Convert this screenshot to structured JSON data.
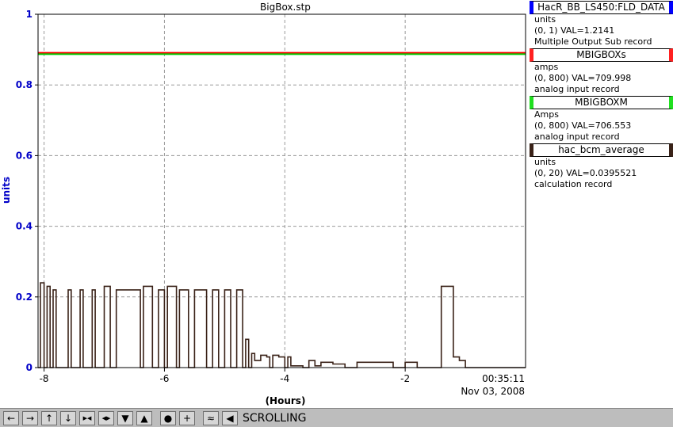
{
  "chart_data": {
    "type": "line",
    "title": "BigBox.stp",
    "xlabel": "(Hours)",
    "ylabel": "units",
    "xlim": [
      -8.1,
      0.0
    ],
    "ylim": [
      0,
      1
    ],
    "x_ticks": [
      "-8",
      "-6",
      "-4",
      "-2"
    ],
    "x_tick_values": [
      -8,
      -6,
      -4,
      -2
    ],
    "y_ticks": [
      "0",
      "0.2",
      "0.4",
      "0.6",
      "0.8",
      "1"
    ],
    "y_tick_values": [
      0,
      0.2,
      0.4,
      0.6,
      0.8,
      1
    ],
    "end_time": "00:35:11",
    "end_date": "Nov 03, 2008",
    "grid": true,
    "series": [
      {
        "name": "HacR_BB_LS450:FLD_DATA",
        "color": "#0000ff",
        "x": [
          -8.1,
          0
        ],
        "y": [
          0.889,
          0.889
        ]
      },
      {
        "name": "MBIGBOXs",
        "color": "#ff0000",
        "x": [
          -8.1,
          0
        ],
        "y": [
          0.891,
          0.891
        ]
      },
      {
        "name": "MBIGBOXM",
        "color": "#00c800",
        "x": [
          -8.1,
          0
        ],
        "y": [
          0.887,
          0.887
        ]
      },
      {
        "name": "hac_bcm_average",
        "color": "#3a2218",
        "x": [
          -8.1,
          -8.06,
          -8.0,
          -7.95,
          -7.9,
          -7.85,
          -7.8,
          -7.6,
          -7.55,
          -7.4,
          -7.35,
          -7.2,
          -7.15,
          -7.0,
          -6.9,
          -6.8,
          -6.7,
          -6.6,
          -6.4,
          -6.35,
          -6.2,
          -6.1,
          -6.0,
          -5.95,
          -5.8,
          -5.75,
          -5.6,
          -5.5,
          -5.4,
          -5.3,
          -5.2,
          -5.1,
          -5.0,
          -4.9,
          -4.8,
          -4.7,
          -4.65,
          -4.6,
          -4.55,
          -4.5,
          -4.4,
          -4.3,
          -4.25,
          -4.2,
          -4.1,
          -4.0,
          -3.95,
          -3.9,
          -3.8,
          -3.7,
          -3.6,
          -3.5,
          -3.4,
          -3.3,
          -3.2,
          -3.0,
          -2.8,
          -2.6,
          -2.4,
          -2.2,
          -2.0,
          -1.8,
          -1.5,
          -1.4,
          -1.2,
          -1.1,
          -1.0,
          -0.8,
          -0.5,
          0.0
        ],
        "y": [
          0.0,
          0.24,
          0.0,
          0.23,
          0.0,
          0.22,
          0.0,
          0.22,
          0.0,
          0.22,
          0.0,
          0.22,
          0.0,
          0.23,
          0.0,
          0.22,
          0.22,
          0.22,
          0.0,
          0.23,
          0.0,
          0.22,
          0.0,
          0.23,
          0.0,
          0.22,
          0.0,
          0.22,
          0.22,
          0.0,
          0.22,
          0.0,
          0.22,
          0.0,
          0.22,
          0.0,
          0.08,
          0.0,
          0.04,
          0.02,
          0.035,
          0.03,
          0.0,
          0.035,
          0.03,
          0.0,
          0.03,
          0.005,
          0.005,
          0.0,
          0.02,
          0.005,
          0.015,
          0.015,
          0.01,
          0.0,
          0.015,
          0.015,
          0.015,
          0.0,
          0.015,
          0.0,
          0.0,
          0.23,
          0.03,
          0.02,
          0.0,
          0.0,
          0.0,
          0.0
        ]
      }
    ]
  },
  "legend": [
    {
      "name": "HacR_BB_LS450:FLD_DATA",
      "color": "#0000ff",
      "units": "units",
      "range_val": "(0, 1) VAL=1.2141",
      "record": "Multiple Output Sub record"
    },
    {
      "name": "MBIGBOXs",
      "color": "#ff2020",
      "units": "amps",
      "range_val": "(0, 800) VAL=709.998",
      "record": "analog input record"
    },
    {
      "name": "MBIGBOXM",
      "color": "#20e020",
      "units": "Amps",
      "range_val": "(0, 800) VAL=706.553",
      "record": "analog input record"
    },
    {
      "name": "hac_bcm_average",
      "color": "#3a2218",
      "units": "units",
      "range_val": "(0, 20) VAL=0.0395521",
      "record": "calculation record"
    }
  ],
  "toolbar": {
    "buttons": [
      "pan-left-icon",
      "pan-right-icon",
      "pan-up-icon",
      "pan-down-icon",
      "zoom-in-x-icon",
      "zoom-out-x-icon",
      "zoom-in-y-icon",
      "zoom-out-y-icon",
      "circle-icon",
      "plus-icon",
      "autoscale-icon",
      "rewind-icon"
    ],
    "mode_label": "SCROLLING"
  }
}
